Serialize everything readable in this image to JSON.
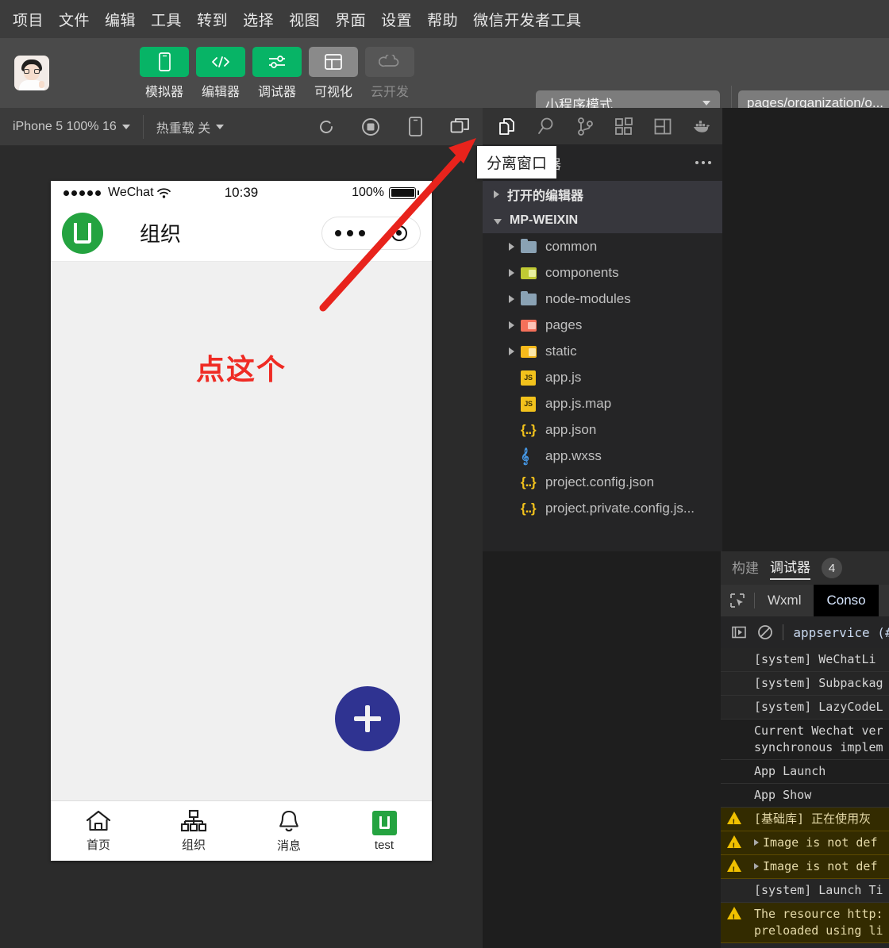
{
  "menubar": {
    "items": [
      {
        "label": "项目"
      },
      {
        "label": "文件"
      },
      {
        "label": "编辑"
      },
      {
        "label": "工具"
      },
      {
        "label": "转到"
      },
      {
        "label": "选择"
      },
      {
        "label": "视图"
      },
      {
        "label": "界面"
      },
      {
        "label": "设置"
      },
      {
        "label": "帮助"
      },
      {
        "label": "微信开发者工具"
      }
    ]
  },
  "toolbar": {
    "buttons": [
      {
        "label": "模拟器",
        "icon": "phone-icon",
        "state": "active-green"
      },
      {
        "label": "编辑器",
        "icon": "code-icon",
        "state": "active-green"
      },
      {
        "label": "调试器",
        "icon": "sliders-icon",
        "state": "active-green"
      },
      {
        "label": "可视化",
        "icon": "layout-icon",
        "state": "grey"
      },
      {
        "label": "云开发",
        "icon": "cloud-icon",
        "state": "disabled"
      }
    ],
    "mode_select": "小程序模式",
    "url_value": "pages/organization/o...",
    "accent_green": "#07b466"
  },
  "devicebar": {
    "device": "iPhone 5 100% 16",
    "hot_reload": "热重载 关",
    "icons": [
      {
        "name": "refresh-icon"
      },
      {
        "name": "stop-icon"
      },
      {
        "name": "phone-preview-icon"
      },
      {
        "name": "detach-window-icon"
      }
    ]
  },
  "tooltip": {
    "text": "分离窗口"
  },
  "simulator": {
    "statusbar": {
      "carrier": "WeChat",
      "time": "10:39",
      "battery": "100%"
    },
    "navbar": {
      "title": "组织",
      "logo_letter": "U",
      "logo_color": "#24a340"
    },
    "page": {
      "hint": "点这个",
      "hint_color": "#ef2b24",
      "fab_color": "#2f3391",
      "fab_icon": "plus-icon"
    },
    "tabbar": [
      {
        "label": "首页",
        "icon": "home-icon"
      },
      {
        "label": "组织",
        "icon": "org-chart-icon"
      },
      {
        "label": "消息",
        "icon": "bell-icon"
      },
      {
        "label": "test",
        "icon": "app-logo-icon"
      }
    ]
  },
  "activitybar": {
    "icons": [
      {
        "name": "files-icon",
        "active": true
      },
      {
        "name": "search-icon",
        "active": false
      },
      {
        "name": "source-control-icon",
        "active": false
      },
      {
        "name": "extensions-icon",
        "active": false
      },
      {
        "name": "layout-panel-icon",
        "active": false
      },
      {
        "name": "docker-icon",
        "active": false
      }
    ]
  },
  "explorer": {
    "title": "资源管理器",
    "sections": [
      {
        "label": "打开的编辑器",
        "open": false
      },
      {
        "label": "MP-WEIXIN",
        "open": true
      }
    ],
    "tree": [
      {
        "label": "common",
        "type": "folder",
        "icon": "folder-blue-icon",
        "expandable": true
      },
      {
        "label": "components",
        "type": "folder",
        "icon": "folder-lime-icon",
        "expandable": true
      },
      {
        "label": "node-modules",
        "type": "folder",
        "icon": "folder-blue-icon",
        "expandable": true
      },
      {
        "label": "pages",
        "type": "folder",
        "icon": "folder-orange-icon",
        "expandable": true
      },
      {
        "label": "static",
        "type": "folder",
        "icon": "folder-yellow-icon",
        "expandable": true
      },
      {
        "label": "app.js",
        "type": "file",
        "icon": "js-file-icon",
        "expandable": false
      },
      {
        "label": "app.js.map",
        "type": "file",
        "icon": "js-map-file-icon",
        "expandable": false
      },
      {
        "label": "app.json",
        "type": "file",
        "icon": "json-file-icon",
        "expandable": false
      },
      {
        "label": "app.wxss",
        "type": "file",
        "icon": "css-file-icon",
        "expandable": false
      },
      {
        "label": "project.config.json",
        "type": "file",
        "icon": "json-file-icon",
        "expandable": false
      },
      {
        "label": "project.private.config.js...",
        "type": "file",
        "icon": "json-file-icon",
        "expandable": false
      }
    ]
  },
  "debugger": {
    "tabs": [
      {
        "label": "构建",
        "active": false
      },
      {
        "label": "调试器",
        "active": true
      }
    ],
    "badge": "4",
    "subtabs": [
      {
        "label": "Wxml",
        "active": false
      },
      {
        "label": "Conso",
        "active": true
      }
    ],
    "picker_icon": "element-picker-icon",
    "filter": {
      "run_icon": "step-icon",
      "clear_icon": "clear-console-icon",
      "source": "appservice (#"
    },
    "logs": [
      {
        "text": "[system] WeChatLi",
        "level": "system"
      },
      {
        "text": "[system] Subpackag",
        "level": "system"
      },
      {
        "text": "[system] LazyCodeL",
        "level": "system"
      },
      {
        "text": "Current Wechat ver\nsynchronous implem",
        "level": "info"
      },
      {
        "text": "App Launch",
        "level": "info"
      },
      {
        "text": "App Show",
        "level": "info"
      },
      {
        "text": "[基础库] 正在使用灰",
        "level": "warn"
      },
      {
        "text": "Image is not def",
        "level": "warn",
        "expandable": true
      },
      {
        "text": "Image is not def",
        "level": "warn",
        "expandable": true
      },
      {
        "text": "[system] Launch Ti",
        "level": "system"
      },
      {
        "text": "The resource http:",
        "level": "warn",
        "link": "http:",
        "line2": "preloaded using li"
      }
    ]
  },
  "annotation": {
    "arrow_color": "#e8231c"
  }
}
